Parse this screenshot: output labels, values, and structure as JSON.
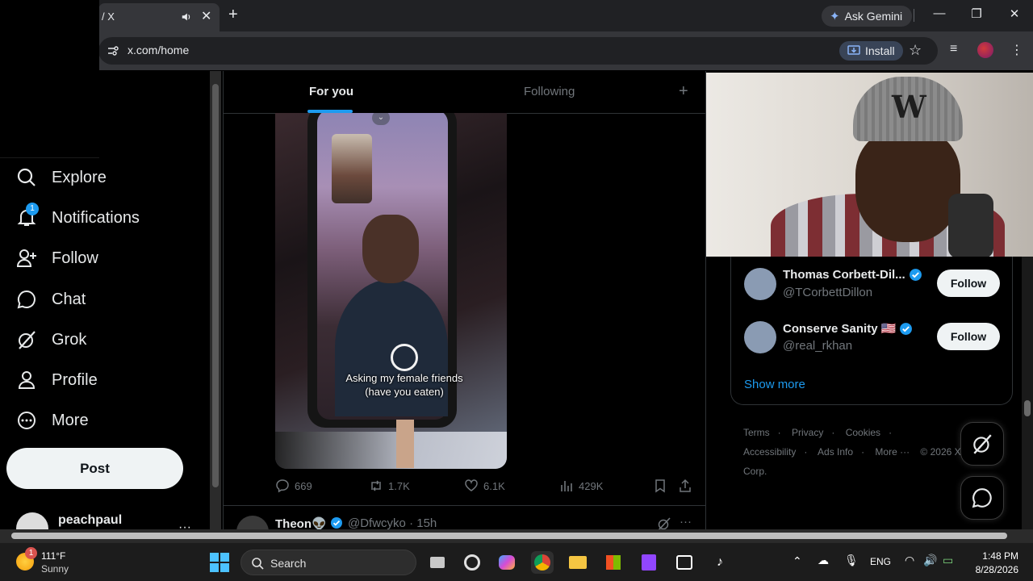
{
  "browser": {
    "tab_title": "/ X",
    "ask_gemini": "Ask Gemini",
    "url": "x.com/home",
    "install_label": "Install"
  },
  "sidebar": {
    "items": [
      {
        "label": "Explore",
        "icon": "search-icon"
      },
      {
        "label": "Notifications",
        "icon": "bell-icon",
        "badge": "1"
      },
      {
        "label": "Follow",
        "icon": "add-user-icon"
      },
      {
        "label": "Chat",
        "icon": "chat-icon"
      },
      {
        "label": "Grok",
        "icon": "grok-icon"
      },
      {
        "label": "Profile",
        "icon": "person-icon"
      },
      {
        "label": "More",
        "icon": "more-circle-icon"
      }
    ],
    "post_label": "Post",
    "account_name": "peachpaul",
    "account_more": "···"
  },
  "timeline": {
    "tabs": [
      {
        "label": "For you"
      },
      {
        "label": "Following"
      }
    ],
    "add_tab": "+",
    "video_caption_line1": "Asking my female friends",
    "video_caption_line2": "(have you eaten)",
    "actions": {
      "replies": "669",
      "reposts": "1.7K",
      "likes": "6.1K",
      "views": "429K"
    },
    "next_post": {
      "name": "Theon👽",
      "handle": "@Dfwcyko · 15h",
      "more": "···"
    }
  },
  "who_to_follow": [
    {
      "name": "Thomas Corbett-Dil...",
      "handle": "@TCorbettDillon",
      "button": "Follow"
    },
    {
      "name": "Conserve Sanity 🇺🇸",
      "handle": "@real_rkhan",
      "button": "Follow"
    }
  ],
  "show_more": "Show more",
  "footer": {
    "links": [
      "Terms",
      "·",
      "Privacy",
      "·",
      "Cookies",
      "·",
      "Accessibility",
      "·",
      "Ads Info",
      "·",
      "More ···",
      "© 2026 X Corp."
    ]
  },
  "taskbar": {
    "weather_temp": "111°F",
    "weather_cond": "Sunny",
    "weather_badge": "1",
    "search_label": "Search",
    "language": "ENG",
    "time": "1:48 PM",
    "date": "8/28/2026"
  },
  "colors": {
    "accent": "#1d9bf0",
    "background": "#000000",
    "text": "#e7e9ea",
    "muted": "#71767b"
  }
}
